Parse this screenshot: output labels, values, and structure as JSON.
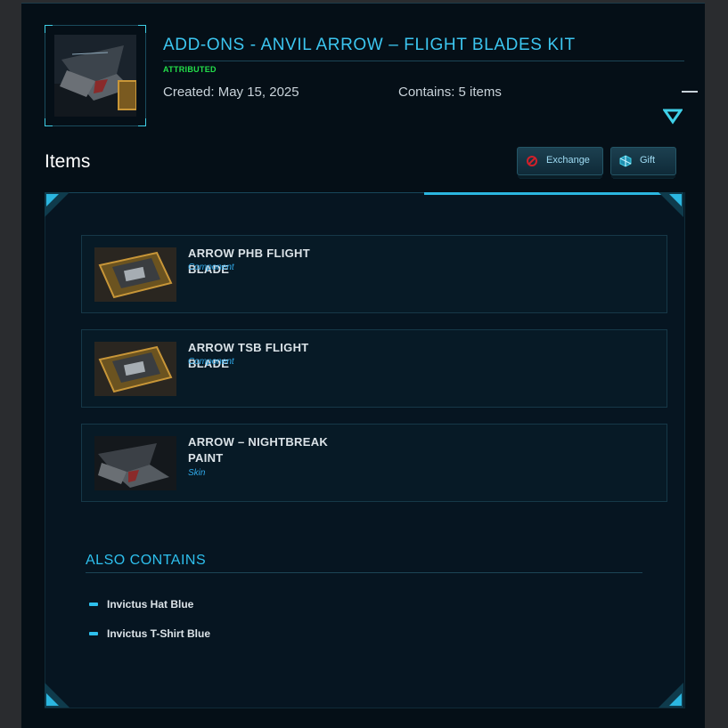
{
  "header": {
    "title": "ADD-ONS - ANVIL ARROW – FLIGHT BLADES KIT",
    "status": "ATTRIBUTED",
    "created": "Created: May 15, 2025",
    "contains": "Contains: 5 items",
    "thumbnail_icon": "anvil-arrow-ship-image"
  },
  "items_section": {
    "heading": "Items",
    "buttons": [
      {
        "label": "Exchange",
        "icon": "exchange-icon",
        "color": "#d0202a"
      },
      {
        "label": "Gift",
        "icon": "gift-icon",
        "color": "#3fd0e8"
      }
    ],
    "items": [
      {
        "name": "ARROW PHB FLIGHT BLADE",
        "type": "Component",
        "image": "flight-blade-image"
      },
      {
        "name": "ARROW TSB FLIGHT BLADE",
        "type": "Component",
        "image": "flight-blade-image"
      },
      {
        "name": "ARROW – NIGHTBREAK PAINT",
        "type": "Skin",
        "image": "ship-paint-image"
      }
    ]
  },
  "also_contains": {
    "title": "ALSO CONTAINS",
    "items": [
      "Invictus Hat Blue",
      "Invictus T-Shirt Blue"
    ]
  },
  "colors": {
    "accent": "#3cc6f0",
    "status": "#23e04a",
    "background": "#050f17",
    "item_type": "#2fa8e8"
  }
}
